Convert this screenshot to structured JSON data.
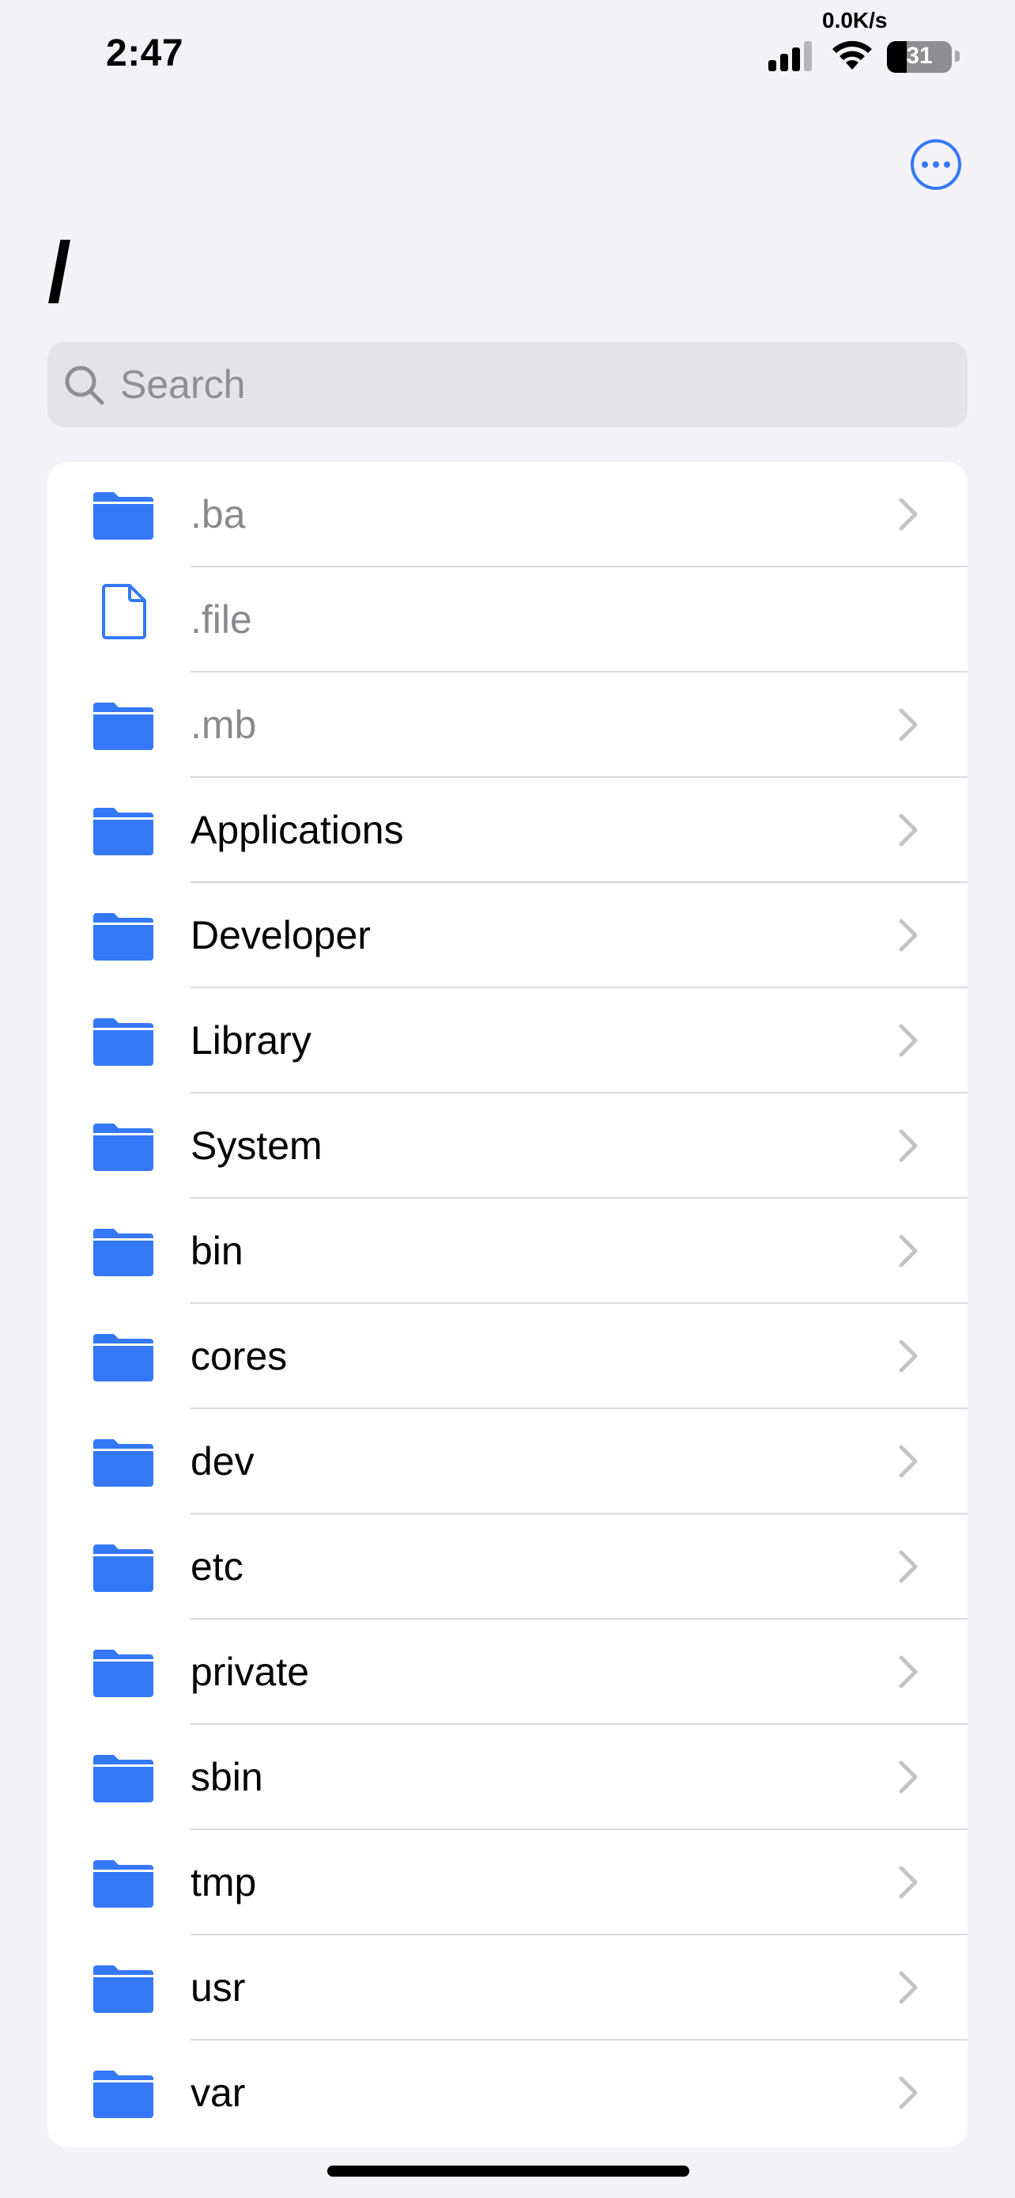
{
  "status_bar": {
    "time": "2:47",
    "network_speed": "0.0K/s",
    "battery_level": "31",
    "battery_fraction": 0.31
  },
  "header": {
    "title": "/",
    "more_icon": "ellipsis-circle-icon"
  },
  "search": {
    "placeholder": "Search",
    "value": ""
  },
  "colors": {
    "accent": "#3478f6",
    "background": "#f2f2f7",
    "dim_text": "#8a8a8e"
  },
  "items": [
    {
      "name": ".ba",
      "type": "folder",
      "hidden": true
    },
    {
      "name": ".file",
      "type": "file",
      "hidden": true
    },
    {
      "name": ".mb",
      "type": "folder",
      "hidden": true
    },
    {
      "name": "Applications",
      "type": "folder",
      "hidden": false
    },
    {
      "name": "Developer",
      "type": "folder",
      "hidden": false
    },
    {
      "name": "Library",
      "type": "folder",
      "hidden": false
    },
    {
      "name": "System",
      "type": "folder",
      "hidden": false
    },
    {
      "name": "bin",
      "type": "folder",
      "hidden": false
    },
    {
      "name": "cores",
      "type": "folder",
      "hidden": false
    },
    {
      "name": "dev",
      "type": "folder",
      "hidden": false
    },
    {
      "name": "etc",
      "type": "folder",
      "hidden": false
    },
    {
      "name": "private",
      "type": "folder",
      "hidden": false
    },
    {
      "name": "sbin",
      "type": "folder",
      "hidden": false
    },
    {
      "name": "tmp",
      "type": "folder",
      "hidden": false
    },
    {
      "name": "usr",
      "type": "folder",
      "hidden": false
    },
    {
      "name": "var",
      "type": "folder",
      "hidden": false
    }
  ]
}
